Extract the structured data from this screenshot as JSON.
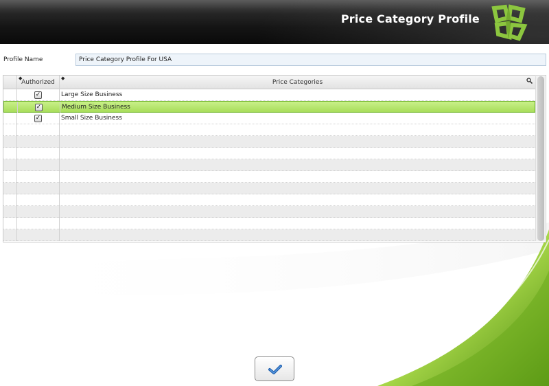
{
  "header": {
    "title": "Price Category Profile",
    "logo_icon": "clover-logo"
  },
  "profile": {
    "label": "Profile Name",
    "value": "Price Category Profile For USA"
  },
  "grid": {
    "columns": [
      "Authorized",
      "Price Categories"
    ],
    "rows": [
      {
        "authorized": true,
        "category": "Large Size Business",
        "selected": false
      },
      {
        "authorized": true,
        "category": "Medium Size Business",
        "selected": true
      },
      {
        "authorized": true,
        "category": "Small Size Business",
        "selected": false
      }
    ],
    "check_glyph": "✓",
    "search_icon": "search-icon",
    "sort_icon": "sort-icon"
  },
  "actions": {
    "confirm_icon": "checkmark-icon"
  },
  "colors": {
    "accent_green": "#8cc63f",
    "selected_row": "#b4e56e",
    "header_bg": "#1a1a1a"
  }
}
